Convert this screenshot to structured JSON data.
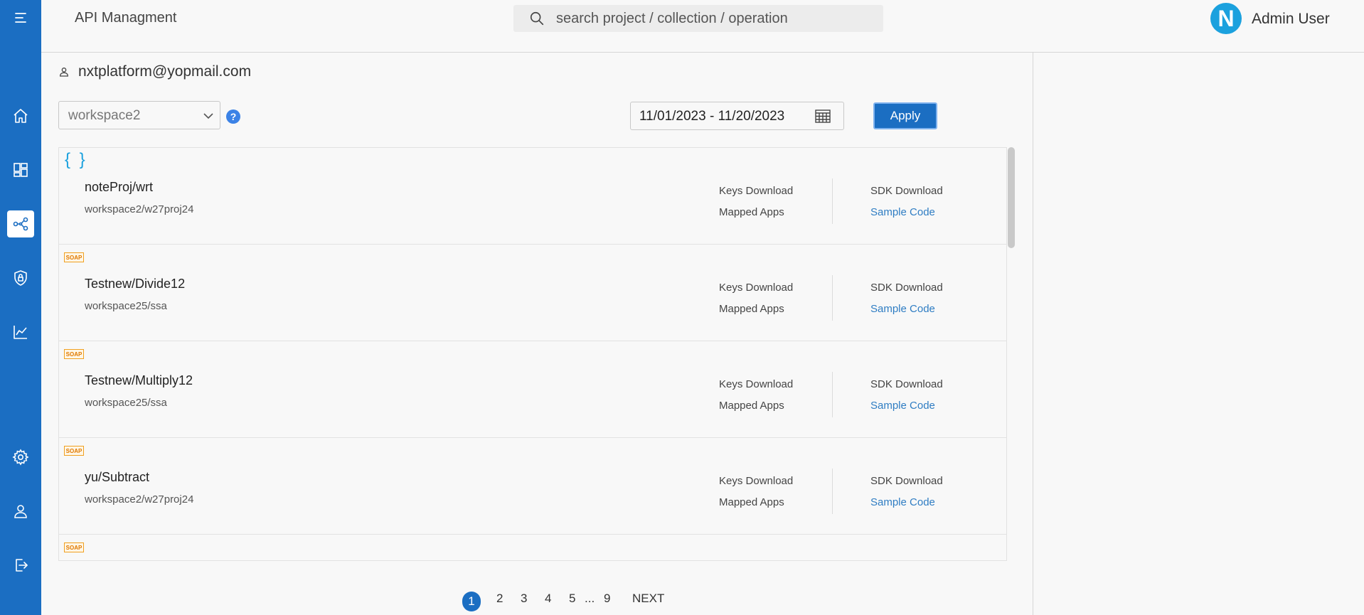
{
  "header": {
    "app_title": "API Managment",
    "search_placeholder": "search project / collection / operation",
    "avatar_letter": "N",
    "user_name": "Admin User"
  },
  "sidebar": {
    "items": [
      {
        "name": "menu-icon"
      },
      {
        "name": "home-icon"
      },
      {
        "name": "dashboard-icon"
      },
      {
        "name": "share-nodes-icon",
        "active": true
      },
      {
        "name": "shield-lock-icon"
      },
      {
        "name": "chart-icon"
      },
      {
        "name": "gear-icon"
      },
      {
        "name": "user-icon"
      },
      {
        "name": "logout-icon"
      }
    ]
  },
  "account": {
    "email": "nxtplatform@yopmail.com"
  },
  "filters": {
    "workspace": "workspace2",
    "help": "?",
    "date_range": "11/01/2023 - 11/20/2023",
    "apply_label": "Apply"
  },
  "list": {
    "rows": [
      {
        "type": "json",
        "type_label": "{ }",
        "name": "noteProj/wrt",
        "path": "workspace2/w27proj24",
        "keys": "Keys Download",
        "mapped": "Mapped Apps",
        "sdk": "SDK Download",
        "sample": "Sample Code"
      },
      {
        "type": "soap",
        "type_label": "SOAP",
        "name": "Testnew/Divide12",
        "path": "workspace25/ssa",
        "keys": "Keys Download",
        "mapped": "Mapped Apps",
        "sdk": "SDK Download",
        "sample": "Sample Code"
      },
      {
        "type": "soap",
        "type_label": "SOAP",
        "name": "Testnew/Multiply12",
        "path": "workspace25/ssa",
        "keys": "Keys Download",
        "mapped": "Mapped Apps",
        "sdk": "SDK Download",
        "sample": "Sample Code"
      },
      {
        "type": "soap",
        "type_label": "SOAP",
        "name": "yu/Subtract",
        "path": "workspace2/w27proj24",
        "keys": "Keys Download",
        "mapped": "Mapped Apps",
        "sdk": "SDK Download",
        "sample": "Sample Code"
      },
      {
        "type": "soap",
        "type_label": "SOAP",
        "name": "",
        "path": "",
        "keys": "",
        "mapped": "",
        "sdk": "",
        "sample": ""
      }
    ]
  },
  "pagination": {
    "pages": [
      "1",
      "2",
      "3",
      "4",
      "5",
      "...",
      "9"
    ],
    "current": "1",
    "next_label": "NEXT"
  },
  "colors": {
    "sidebar": "#1b6ec2",
    "accent": "#1b6ec2",
    "link": "#2f7dc3",
    "json_badge": "#1ba1de",
    "soap_badge": "#e07a00"
  }
}
